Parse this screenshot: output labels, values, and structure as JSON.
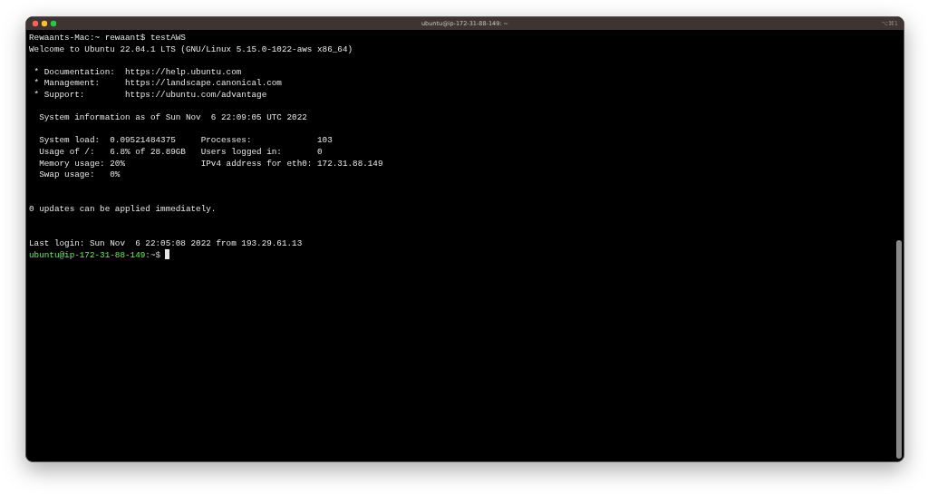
{
  "window": {
    "title": "ubuntu@ip-172-31-88-149: ~",
    "shortcut": "⌥⌘1"
  },
  "terminal": {
    "lines": [
      {
        "kind": "text",
        "text": "Rewaants-Mac:~ rewaant$ testAWS"
      },
      {
        "kind": "text",
        "text": "Welcome to Ubuntu 22.04.1 LTS (GNU/Linux 5.15.0-1022-aws x86_64)"
      },
      {
        "kind": "blank"
      },
      {
        "kind": "text",
        "text": " * Documentation:  https://help.ubuntu.com"
      },
      {
        "kind": "text",
        "text": " * Management:     https://landscape.canonical.com"
      },
      {
        "kind": "text",
        "text": " * Support:        https://ubuntu.com/advantage"
      },
      {
        "kind": "blank"
      },
      {
        "kind": "text",
        "text": "  System information as of Sun Nov  6 22:09:05 UTC 2022"
      },
      {
        "kind": "blank"
      },
      {
        "kind": "text",
        "text": "  System load:  0.09521484375     Processes:             103"
      },
      {
        "kind": "text",
        "text": "  Usage of /:   6.8% of 28.89GB   Users logged in:       0"
      },
      {
        "kind": "text",
        "text": "  Memory usage: 20%               IPv4 address for eth0: 172.31.88.149"
      },
      {
        "kind": "text",
        "text": "  Swap usage:   0%"
      },
      {
        "kind": "blank"
      },
      {
        "kind": "blank"
      },
      {
        "kind": "text",
        "text": "0 updates can be applied immediately."
      },
      {
        "kind": "blank"
      },
      {
        "kind": "blank"
      },
      {
        "kind": "text",
        "text": "Last login: Sun Nov  6 22:05:08 2022 from 193.29.61.13"
      },
      {
        "kind": "prompt",
        "user": "ubuntu@ip-172-31-88-149",
        "path": ":~$"
      }
    ]
  }
}
